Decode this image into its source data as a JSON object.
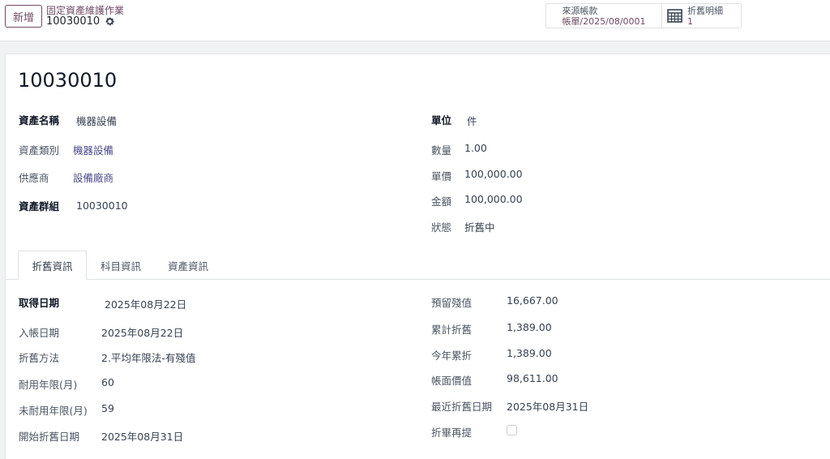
{
  "control_panel": {
    "new_button": "新增",
    "breadcrumb_parent": "固定資產維護作業",
    "breadcrumb_current": "10030010",
    "smart_buttons": {
      "source": {
        "title": "來源帳款",
        "value": "帳單/2025/08/0001"
      },
      "depreciation": {
        "title": "折舊明細",
        "value": "1",
        "icon": "calendar-grid-icon"
      }
    }
  },
  "record": {
    "title": "10030010",
    "left_fields": [
      {
        "label": "資產名稱",
        "value": "機器設備"
      },
      {
        "label": "資產類別",
        "value": "機器設備"
      },
      {
        "label": "供應商",
        "value": "設備廠商"
      },
      {
        "label": "資產群組",
        "value": "10030010"
      }
    ],
    "right_fields": [
      {
        "label": "單位",
        "value": "件"
      },
      {
        "label": "數量",
        "value": "1.00"
      },
      {
        "label": "單價",
        "value": "100,000.00"
      },
      {
        "label": "金額",
        "value": "100,000.00"
      },
      {
        "label": "狀態",
        "value": "折舊中"
      }
    ]
  },
  "tabs": [
    {
      "label": "折舊資訊",
      "active": true
    },
    {
      "label": "科目資訊",
      "active": false
    },
    {
      "label": "資產資訊",
      "active": false
    }
  ],
  "depreciation_tab": {
    "left_fields": [
      {
        "label": "取得日期",
        "value": "2025年08月22日"
      },
      {
        "label": "入帳日期",
        "value": "2025年08月22日"
      },
      {
        "label": "折舊方法",
        "value": "2.平均年限法-有殘值"
      },
      {
        "label": "耐用年限(月)",
        "value": "60"
      },
      {
        "label": "未耐用年限(月)",
        "value": "59"
      },
      {
        "label": "開始折舊日期",
        "value": "2025年08月31日"
      }
    ],
    "right_fields": [
      {
        "label": "預留殘值",
        "value": "16,667.00"
      },
      {
        "label": "累計折舊",
        "value": "1,389.00"
      },
      {
        "label": "今年累折",
        "value": "1,389.00"
      },
      {
        "label": "帳面價值",
        "value": "98,611.00"
      },
      {
        "label": "最近折舊日期",
        "value": "2025年08月31日"
      },
      {
        "label": "折畢再提",
        "checked": false
      }
    ]
  },
  "colors": {
    "accent": "#714b67",
    "link": "#4b4b8a"
  }
}
